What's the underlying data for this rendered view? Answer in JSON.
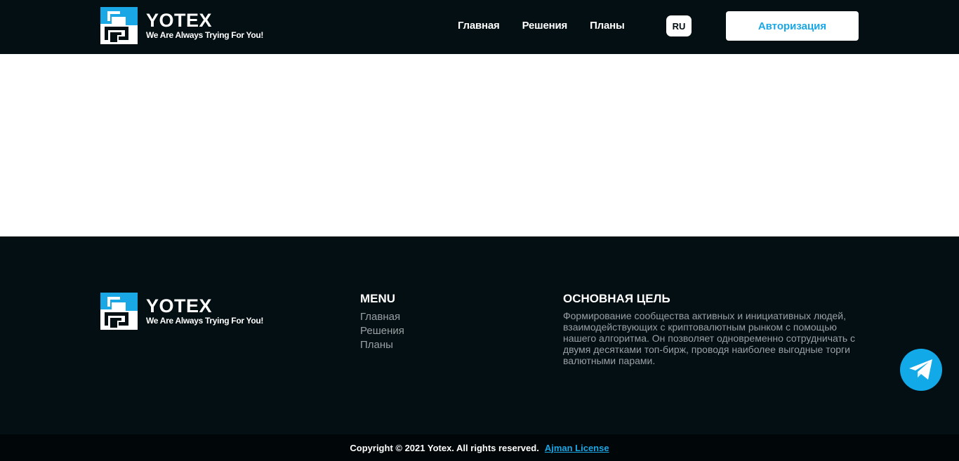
{
  "brand": {
    "name": "YOTEX",
    "tagline": "We Are Always Trying For You!",
    "accent_color": "#1aa7e6",
    "dark_color": "#030f13"
  },
  "header": {
    "nav": [
      {
        "label": "Главная"
      },
      {
        "label": "Решения"
      },
      {
        "label": "Планы"
      }
    ],
    "language": "RU",
    "login_label": "Авторизация"
  },
  "footer": {
    "menu_title": "MENU",
    "menu_items": [
      {
        "label": "Главная"
      },
      {
        "label": "Решения"
      },
      {
        "label": "Планы"
      }
    ],
    "goal_title": "ОСНОВНАЯ ЦЕЛЬ",
    "goal_text": "Формирование сообщества активных и инициативных людей, взаимодействующих с криптовалютным рынком с помощью нашего алгоритма. Он позволяет одновременно сотрудничать с двумя десятками топ-бирж, проводя наиболее выгодные торги валютными парами.",
    "copyright": "Copyright © 2021 Yotex. All rights reserved.",
    "license_link": "Ajman License"
  },
  "widgets": {
    "telegram_icon": "telegram-icon"
  }
}
